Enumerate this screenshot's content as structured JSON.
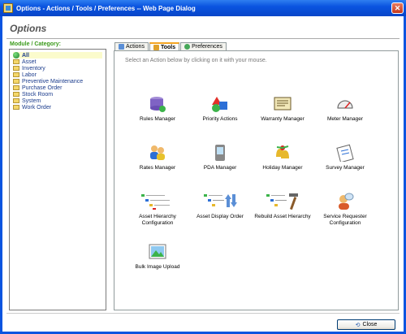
{
  "window": {
    "title": "Options - Actions / Tools / Preferences -- Web Page Dialog",
    "close_glyph": "✕"
  },
  "page_title": "Options",
  "module_label": "Module / Category:",
  "modules": [
    {
      "label": "All",
      "icon": "globe-icon",
      "selected": true
    },
    {
      "label": "Asset",
      "icon": "folder-icon"
    },
    {
      "label": "Inventory",
      "icon": "folder-icon"
    },
    {
      "label": "Labor",
      "icon": "folder-icon"
    },
    {
      "label": "Preventive Maintenance",
      "icon": "folder-icon"
    },
    {
      "label": "Purchase Order",
      "icon": "folder-icon"
    },
    {
      "label": "Stock Room",
      "icon": "folder-icon"
    },
    {
      "label": "System",
      "icon": "folder-icon"
    },
    {
      "label": "Work Order",
      "icon": "folder-icon"
    }
  ],
  "tabs": [
    {
      "label": "Actions",
      "active": false
    },
    {
      "label": "Tools",
      "active": true
    },
    {
      "label": "Preferences",
      "active": false
    }
  ],
  "instruction": "Select an Action below by clicking on it with your mouse.",
  "actions": [
    {
      "label": "Rules Manager",
      "icon": "database-icon"
    },
    {
      "label": "Priority Actions",
      "icon": "shapes-icon"
    },
    {
      "label": "Warranty Manager",
      "icon": "certificate-icon"
    },
    {
      "label": "Meter Manager",
      "icon": "gauge-icon"
    },
    {
      "label": "Rates Manager",
      "icon": "users-icon"
    },
    {
      "label": "PDA Manager",
      "icon": "pda-icon"
    },
    {
      "label": "Holiday Manager",
      "icon": "bells-icon"
    },
    {
      "label": "Survey Manager",
      "icon": "clipboard-icon"
    },
    {
      "label": "Asset Hierarchy Configuration",
      "icon": "hierarchy-tree-icon"
    },
    {
      "label": "Asset Display Order",
      "icon": "sort-order-icon"
    },
    {
      "label": "Rebuild Asset Hierarchy",
      "icon": "hammer-tree-icon"
    },
    {
      "label": "Service Requester Configuration",
      "icon": "person-chat-icon"
    },
    {
      "label": "Bulk Image Upload",
      "icon": "image-icon"
    }
  ],
  "close_button": {
    "label": "Close",
    "icon": "back-arrow-icon"
  }
}
